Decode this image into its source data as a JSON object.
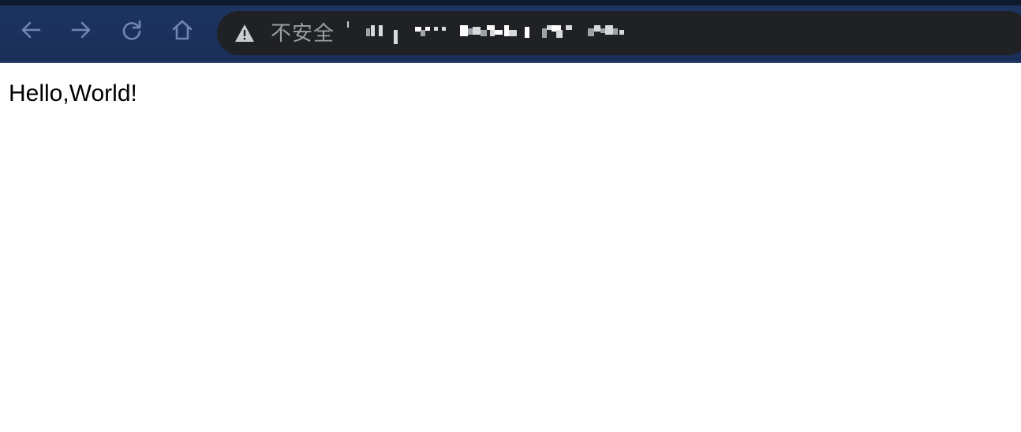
{
  "browser": {
    "toolbar": {
      "back_icon": "arrow-left-icon",
      "forward_icon": "arrow-right-icon",
      "reload_icon": "reload-icon",
      "home_icon": "home-icon"
    },
    "omnibox": {
      "security_icon": "warning-triangle-icon",
      "security_label": "不安全",
      "url_redacted": true
    },
    "colors": {
      "toolbar_bg": "#1d3461",
      "omnibox_bg": "#202124",
      "icon_color": "#6f86b3",
      "security_text": "#9aa0a6"
    }
  },
  "page": {
    "body_text": "Hello,World!"
  }
}
